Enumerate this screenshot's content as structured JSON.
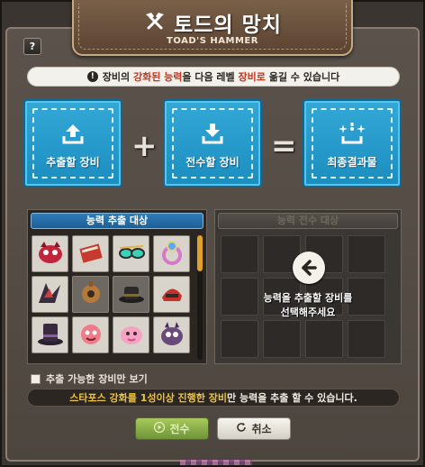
{
  "window": {
    "title": "토드의 망치",
    "subtitle": "TOAD'S HAMMER",
    "help_label": "?"
  },
  "notice": {
    "prefix": "장비의 ",
    "highlight1": "강화된 능력",
    "middle": "을 다음 레벨 ",
    "highlight2": "장비로",
    "suffix": " 옮길 수 있습니다"
  },
  "slots": {
    "source_label": "추출할 장비",
    "target_label": "전수할 장비",
    "result_label": "최종결과물",
    "plus": "+",
    "equals": "="
  },
  "left_panel": {
    "title": "능력 추출 대상",
    "items": [
      {
        "icon": "red-beast-helmet-icon"
      },
      {
        "icon": "red-book-icon"
      },
      {
        "icon": "goggles-icon"
      },
      {
        "icon": "purple-ring-icon"
      },
      {
        "icon": "dark-wing-icon"
      },
      {
        "icon": "steampunk-gear-icon"
      },
      {
        "icon": "black-hat-icon"
      },
      {
        "icon": "red-helmet-icon"
      },
      {
        "icon": "purple-top-hat-icon"
      },
      {
        "icon": "pink-fish-icon"
      },
      {
        "icon": "pink-creature-icon"
      },
      {
        "icon": "purple-monster-icon"
      }
    ]
  },
  "right_panel": {
    "title": "능력 전수 대상",
    "message_line1": "능력을 추출할 장비를",
    "message_line2": "선택해주세요"
  },
  "filter": {
    "label": "추출 가능한 장비만 보기",
    "checked": false
  },
  "bottom_notice": {
    "highlight": "스타포스 강화를 1성이상 진행한 장비",
    "suffix": "만 능력을 추출 할 수 있습니다."
  },
  "buttons": {
    "transfer_label": "전수",
    "cancel_label": "취소"
  },
  "colors": {
    "slot_blue": "#1b8ec0",
    "highlight_red": "#c8341e",
    "highlight_yellow": "#f0c33a",
    "scroll_orange": "#e1a22c"
  }
}
